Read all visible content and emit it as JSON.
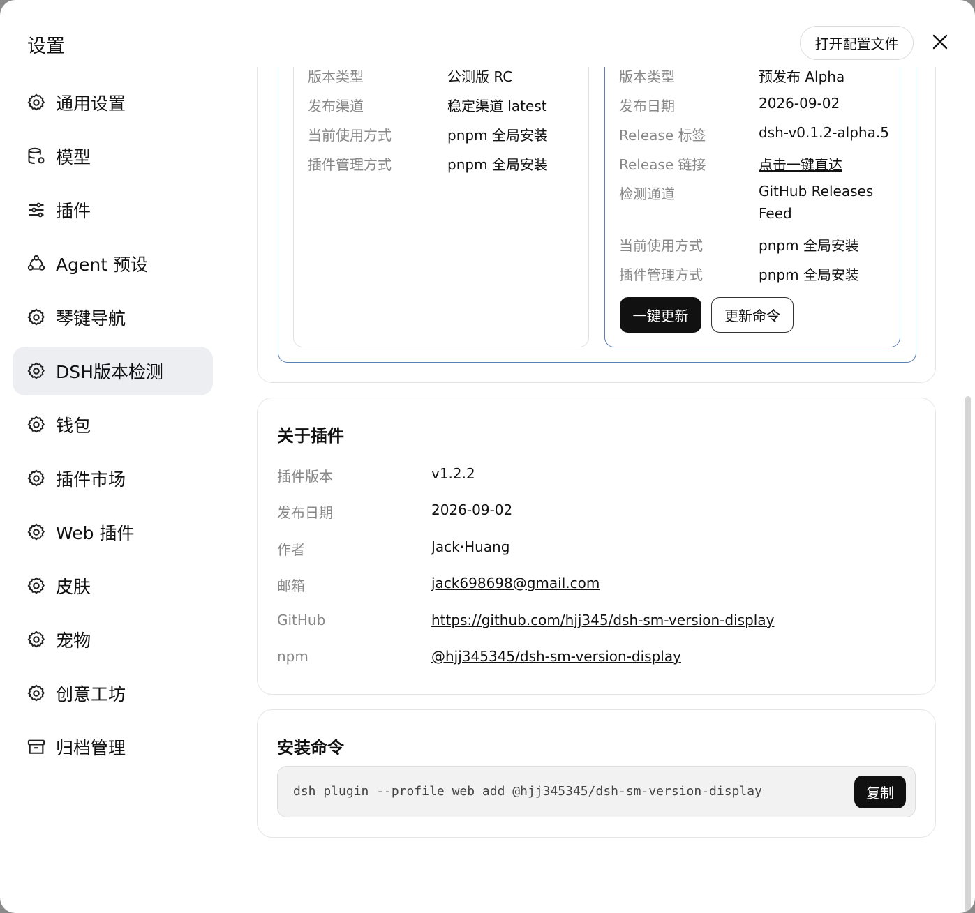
{
  "header": {
    "title": "设置",
    "open_config_label": "打开配置文件",
    "close_icon": "close-icon"
  },
  "sidebar": {
    "items": [
      {
        "label": "通用设置",
        "icon": "gear-icon"
      },
      {
        "label": "模型",
        "icon": "database-gear-icon"
      },
      {
        "label": "插件",
        "icon": "sliders-icon"
      },
      {
        "label": "Agent 预设",
        "icon": "agent-icon"
      },
      {
        "label": "琴键导航",
        "icon": "gear-icon"
      },
      {
        "label": "DSH版本检测",
        "icon": "gear-icon",
        "active": true
      },
      {
        "label": "钱包",
        "icon": "gear-icon"
      },
      {
        "label": "插件市场",
        "icon": "gear-icon"
      },
      {
        "label": "Web 插件",
        "icon": "gear-icon"
      },
      {
        "label": "皮肤",
        "icon": "gear-icon"
      },
      {
        "label": "宠物",
        "icon": "gear-icon"
      },
      {
        "label": "创意工坊",
        "icon": "gear-icon"
      },
      {
        "label": "归档管理",
        "icon": "archive-icon"
      }
    ]
  },
  "version_panels": {
    "left": {
      "rows": [
        {
          "k": "版本类型",
          "v": "公测版 RC"
        },
        {
          "k": "发布渠道",
          "v": "稳定渠道 latest"
        },
        {
          "k": "当前使用方式",
          "v": "pnpm 全局安装"
        },
        {
          "k": "插件管理方式",
          "v": "pnpm 全局安装"
        }
      ]
    },
    "right": {
      "rows": [
        {
          "k": "版本类型",
          "v": "预发布 Alpha"
        },
        {
          "k": "发布日期",
          "v": "2026-09-02"
        },
        {
          "k": "Release 标签",
          "v": "dsh-v0.1.2-alpha.5"
        },
        {
          "k": "Release 链接",
          "v": "点击一键直达"
        },
        {
          "k": "检测通道",
          "v": "GitHub Releases",
          "v2": "Feed"
        },
        {
          "k": "当前使用方式",
          "v": "pnpm 全局安装"
        },
        {
          "k": "插件管理方式",
          "v": "pnpm 全局安装"
        }
      ],
      "update_button": "一键更新",
      "command_button": "更新命令"
    }
  },
  "about": {
    "title": "关于插件",
    "rows": [
      {
        "k": "插件版本",
        "v": "v1.2.2"
      },
      {
        "k": "发布日期",
        "v": "2026-09-02"
      },
      {
        "k": "作者",
        "v": "Jack·Huang"
      },
      {
        "k": "邮箱",
        "v": "jack698698@gmail.com"
      },
      {
        "k": "GitHub",
        "v": "https://github.com/hjj345/dsh-sm-version-display"
      },
      {
        "k": "npm",
        "v": "@hjj345345/dsh-sm-version-display"
      }
    ]
  },
  "install": {
    "title": "安装命令",
    "command": "dsh plugin --profile web add @hjj345345/dsh-sm-version-display",
    "copy_label": "复制"
  }
}
